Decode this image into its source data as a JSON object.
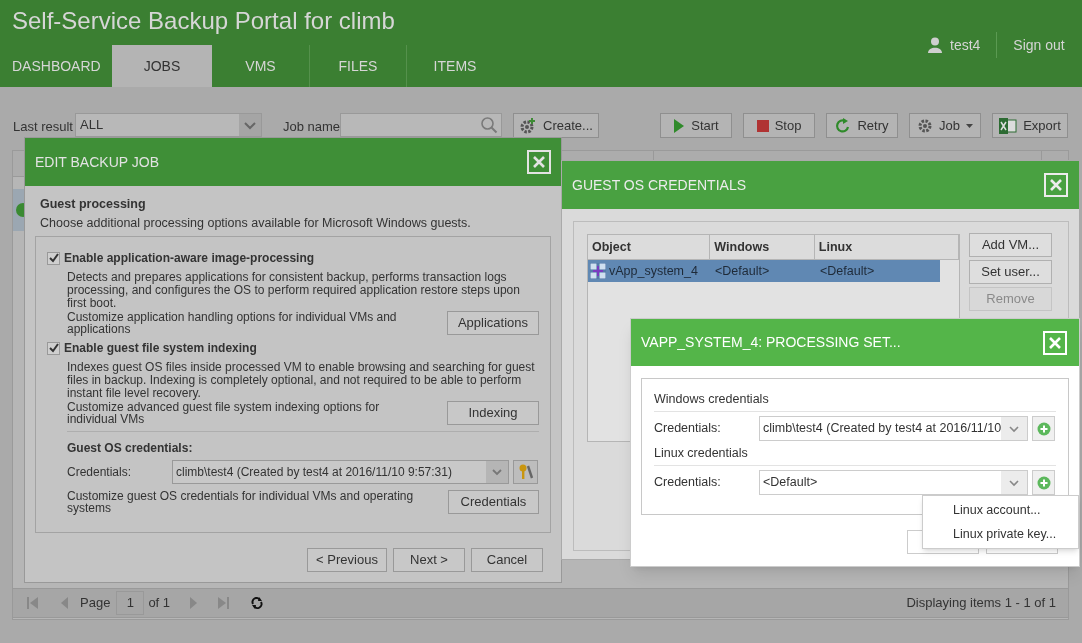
{
  "header": {
    "title": "Self-Service Backup Portal for climb",
    "user": "test4",
    "sign_out": "Sign out"
  },
  "tabs": [
    {
      "label": "DASHBOARD",
      "selected": false
    },
    {
      "label": "JOBS",
      "selected": true
    },
    {
      "label": "VMS",
      "selected": false
    },
    {
      "label": "FILES",
      "selected": false
    },
    {
      "label": "ITEMS",
      "selected": false
    }
  ],
  "toolbar": {
    "last_result_label": "Last result",
    "last_result_value": "ALL",
    "job_name_label": "Job name",
    "create_button": "Create...",
    "buttons": [
      {
        "label": "Start",
        "kind": "start"
      },
      {
        "label": "Stop",
        "kind": "stop"
      },
      {
        "label": "Retry",
        "kind": "retry"
      },
      {
        "label": "Job",
        "kind": "job"
      },
      {
        "label": "Export",
        "kind": "export"
      }
    ]
  },
  "edit_dialog": {
    "title": "EDIT BACKUP JOB",
    "section_title": "Guest processing",
    "section_description": "Choose additional processing options available for Microsoft Windows guests.",
    "options": [
      {
        "label": "Enable application-aware image-processing",
        "checked": true,
        "description": "Detects and prepares applications for consistent backup, performs transaction logs processing, and configures the OS to perform required application restore steps upon first boot.",
        "customize_text": "Customize application handling options for individual VMs and applications",
        "button": "Applications"
      },
      {
        "label": "Enable guest file system indexing",
        "checked": true,
        "description": "Indexes guest OS files inside processed VM to enable browsing and searching for guest files in backup. Indexing is completely optional, and not required to be able to perform instant file level recovery.",
        "customize_text": "Customize advanced guest file system indexing options for individual VMs",
        "button": "Indexing"
      }
    ],
    "credentials": {
      "heading": "Guest OS credentials:",
      "label": "Credentials:",
      "value": "climb\\test4 (Created by test4 at 2016/11/10 9:57:31)",
      "customize_text": "Customize guest OS credentials for individual VMs and operating systems",
      "button": "Credentials"
    },
    "footer_buttons": [
      "< Previous",
      "Next >",
      "Cancel"
    ]
  },
  "guest_dialog": {
    "title": "GUEST OS CREDENTIALS",
    "columns": [
      "Object",
      "Windows",
      "Linux"
    ],
    "rows": [
      {
        "object": "vApp_system_4",
        "windows": "<Default>",
        "linux": "<Default>",
        "selected": true
      }
    ],
    "buttons": [
      {
        "label": "Add VM...",
        "disabled": false
      },
      {
        "label": "Set user...",
        "disabled": false
      },
      {
        "label": "Remove",
        "disabled": true
      }
    ]
  },
  "processing_dialog": {
    "title": "VAPP_SYSTEM_4: PROCESSING SET...",
    "sections": [
      {
        "heading": "Windows credentials",
        "label": "Credentials:",
        "value": "climb\\test4 (Created by test4 at 2016/11/10"
      },
      {
        "heading": "Linux credentials",
        "label": "Credentials:",
        "value": "<Default>"
      }
    ],
    "menu": [
      "Linux account...",
      "Linux private key..."
    ]
  },
  "pager": {
    "page_label": "Page",
    "page_value": "1",
    "of_label": "of 1",
    "summary": "Displaying items 1 - 1 of 1"
  }
}
